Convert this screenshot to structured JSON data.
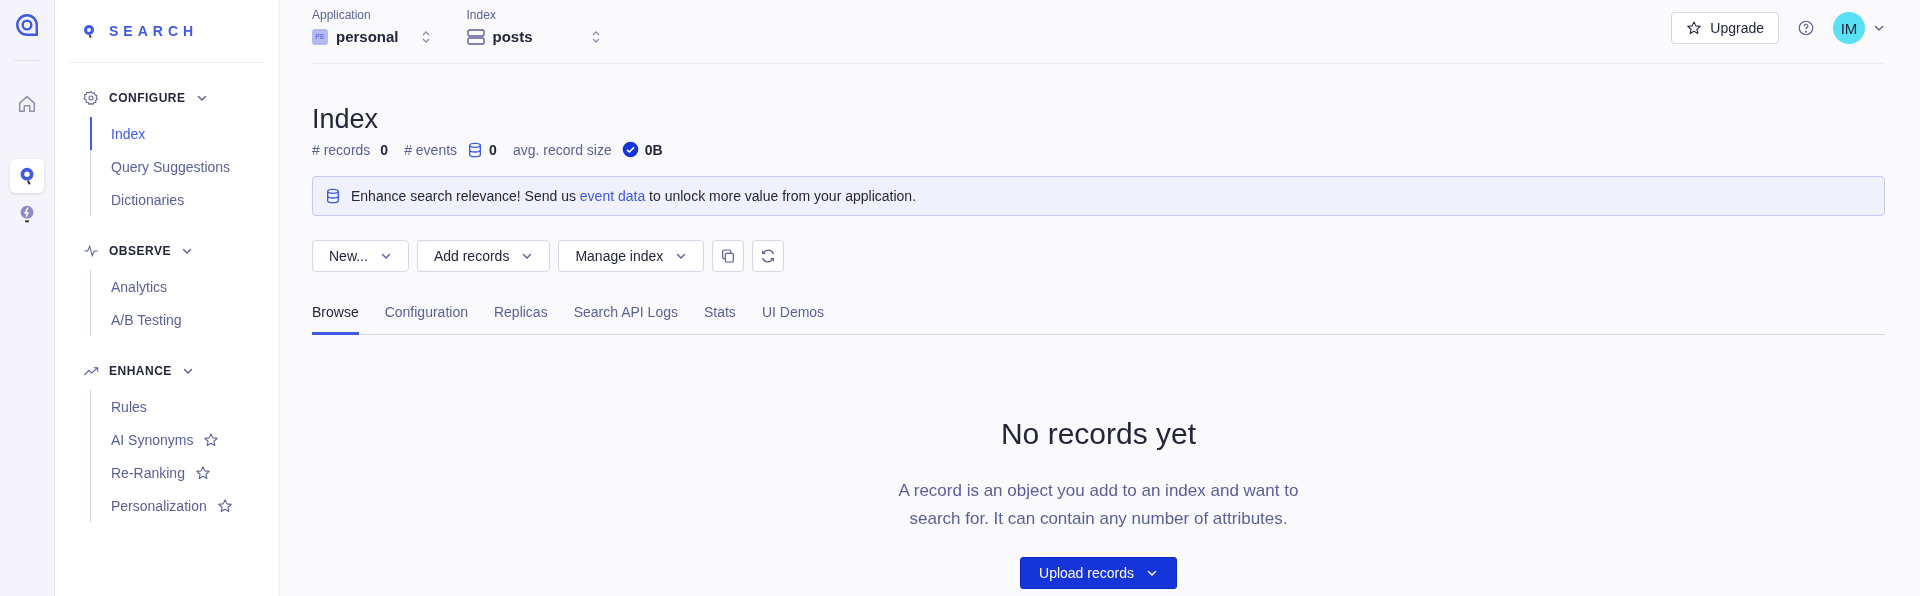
{
  "rail": {
    "items": [
      {
        "kind": "home",
        "selected": false
      },
      {
        "kind": "search",
        "selected": true
      },
      {
        "kind": "bulb",
        "selected": false
      }
    ]
  },
  "sidebar": {
    "brand": "SEARCH",
    "sections": [
      {
        "title": "CONFIGURE",
        "expanded": true,
        "items": [
          {
            "label": "Index",
            "selected": true,
            "starred": false
          },
          {
            "label": "Query Suggestions",
            "selected": false,
            "starred": false
          },
          {
            "label": "Dictionaries",
            "selected": false,
            "starred": false
          }
        ]
      },
      {
        "title": "OBSERVE",
        "expanded": true,
        "items": [
          {
            "label": "Analytics",
            "selected": false,
            "starred": false
          },
          {
            "label": "A/B Testing",
            "selected": false,
            "starred": false
          }
        ]
      },
      {
        "title": "ENHANCE",
        "expanded": true,
        "items": [
          {
            "label": "Rules",
            "selected": false,
            "starred": false
          },
          {
            "label": "AI Synonyms",
            "selected": false,
            "starred": true
          },
          {
            "label": "Re-Ranking",
            "selected": false,
            "starred": true
          },
          {
            "label": "Personalization",
            "selected": false,
            "starred": true
          }
        ]
      }
    ]
  },
  "topbar": {
    "application": {
      "label": "Application",
      "badge": "PE",
      "value": "personal"
    },
    "index": {
      "label": "Index",
      "value": "posts"
    },
    "upgrade": "Upgrade",
    "avatar": "IM"
  },
  "page": {
    "title": "Index",
    "stats": [
      {
        "label": "# records",
        "value": "0"
      },
      {
        "label": "# events",
        "value": "0"
      },
      {
        "label": "avg. record size",
        "value": "0B"
      }
    ],
    "banner": {
      "before": "Enhance search relevance! Send us",
      "link": "event data",
      "after": "to unlock more value from your application."
    },
    "toolbar": [
      {
        "kind": "menu",
        "label": "New..."
      },
      {
        "kind": "menu",
        "label": "Add records"
      },
      {
        "kind": "menu",
        "label": "Manage index"
      },
      {
        "kind": "copy"
      },
      {
        "kind": "refresh"
      }
    ],
    "tabs": [
      {
        "label": "Browse",
        "selected": true
      },
      {
        "label": "Configuration",
        "selected": false
      },
      {
        "label": "Replicas",
        "selected": false
      },
      {
        "label": "Search API Logs",
        "selected": false
      },
      {
        "label": "Stats",
        "selected": false
      },
      {
        "label": "UI Demos",
        "selected": false
      }
    ],
    "empty": {
      "title": "No records yet",
      "text": "A record is an object you add to an index and want to search for. It can contain any number of attributes.",
      "button": "Upload records"
    }
  }
}
